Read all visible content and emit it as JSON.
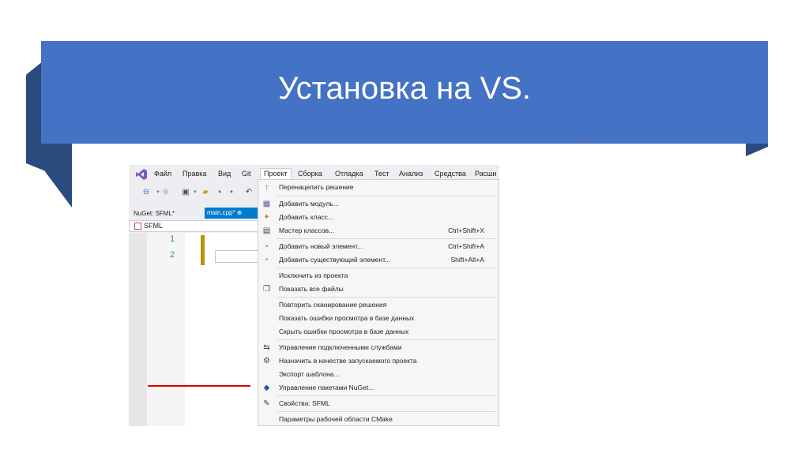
{
  "slide": {
    "title": "Установка на VS."
  },
  "vs": {
    "menubar": [
      "Файл",
      "Правка",
      "Вид",
      "Git",
      "Проект",
      "Сборка",
      "Отладка",
      "Тест",
      "Анализ",
      "Средства",
      "Расши"
    ],
    "active_menu": "Проект",
    "tabs": {
      "nuget": "NuGet: SFML*",
      "main": "main.cpp*  ⊕"
    },
    "nav_project": "SFML",
    "line_numbers": [
      "1",
      "2"
    ],
    "menu_items": [
      {
        "label": "Перенацелить решение",
        "shortcut": "",
        "icon": "retarget-icon"
      },
      {
        "label": "Добавить модуль...",
        "shortcut": "",
        "icon": "add-module-icon"
      },
      {
        "label": "Добавить класс...",
        "shortcut": "",
        "icon": "add-class-icon"
      },
      {
        "label": "Мастер классов...",
        "shortcut": "Ctrl+Shift+X",
        "icon": "class-wizard-icon"
      },
      {
        "label": "Добавить новый элемент...",
        "shortcut": "Ctrl+Shift+A",
        "icon": "new-item-icon"
      },
      {
        "label": "Добавить существующий элемент...",
        "shortcut": "Shift+Alt+A",
        "icon": "existing-item-icon"
      },
      {
        "label": "Исключить из проекта",
        "shortcut": "",
        "icon": ""
      },
      {
        "label": "Показать все файлы",
        "shortcut": "",
        "icon": "show-files-icon"
      },
      {
        "label": "Повторить сканирование решения",
        "shortcut": "",
        "icon": ""
      },
      {
        "label": "Показать ошибки просмотра в базе данных",
        "shortcut": "",
        "icon": ""
      },
      {
        "label": "Скрыть ошибки просмотра в базе данных",
        "shortcut": "",
        "icon": ""
      },
      {
        "label": "Управление подключенными службами",
        "shortcut": "",
        "icon": "services-icon"
      },
      {
        "label": "Назначить в качестве запускаемого проекта",
        "shortcut": "",
        "icon": "gear-icon"
      },
      {
        "label": "Экспорт шаблона...",
        "shortcut": "",
        "icon": ""
      },
      {
        "label": "Управление пакетами NuGet...",
        "shortcut": "",
        "icon": "nuget-icon"
      },
      {
        "label": "Свойства: SFML",
        "shortcut": "",
        "icon": "wrench-icon"
      },
      {
        "label": "Параметры рабочей области CMake",
        "shortcut": "",
        "icon": ""
      }
    ]
  }
}
